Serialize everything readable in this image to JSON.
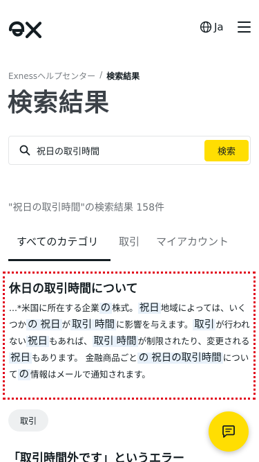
{
  "header": {
    "logo_alt": "ex",
    "language": "Ja"
  },
  "breadcrumb": {
    "home": "Exnessヘルプセンター",
    "separator": "/",
    "current": "検索結果"
  },
  "page_title": "検索結果",
  "search": {
    "value": "祝日の取引時間",
    "button_label": "検索"
  },
  "result_count": "\"祝日の取引時間\"の検索結果 158件",
  "tabs": [
    {
      "label": "すべてのカテゴリ",
      "active": true
    },
    {
      "label": "取引",
      "active": false
    },
    {
      "label": "マイアカウント",
      "active": false
    }
  ],
  "results": [
    {
      "title": "休日の取引時間について",
      "snippet": [
        {
          "t": "...*米国に所在する企業"
        },
        {
          "t": "の",
          "hl": true
        },
        {
          "t": "株式。"
        },
        {
          "t": "祝日",
          "hl": true
        },
        {
          "t": "地域によっては、いくつか"
        },
        {
          "t": "の",
          "hl": true
        },
        {
          "t": "祝日",
          "hl": true
        },
        {
          "t": "が"
        },
        {
          "t": "取引",
          "hl": true
        },
        {
          "t": "時間",
          "hl": true
        },
        {
          "t": "に影響を与えます。"
        },
        {
          "t": "取引",
          "hl": true
        },
        {
          "t": "が行われない"
        },
        {
          "t": "祝日",
          "hl": true
        },
        {
          "t": "もあれば、"
        },
        {
          "t": "取引",
          "hl": true
        },
        {
          "t": "時間",
          "hl": true
        },
        {
          "t": "が制限されたり、変更される"
        },
        {
          "t": "祝日",
          "hl": true
        },
        {
          "t": "もあります。 金融商品ごと"
        },
        {
          "t": "の",
          "hl": true
        },
        {
          "t": "祝日の取引時間",
          "hl": true
        },
        {
          "t": "について"
        },
        {
          "t": "の",
          "hl": true
        },
        {
          "t": "情報はメールで通知されます。"
        }
      ],
      "category": "取引"
    },
    {
      "title": "「取引時間外です」というエラー"
    }
  ],
  "colors": {
    "accent": "#ffde02",
    "highlight": "#e8f1fa",
    "outline": "#e1001a",
    "text": "#141d22"
  },
  "icons": [
    "logo-icon",
    "globe-icon",
    "hamburger-menu-icon",
    "search-icon",
    "chat-icon"
  ]
}
